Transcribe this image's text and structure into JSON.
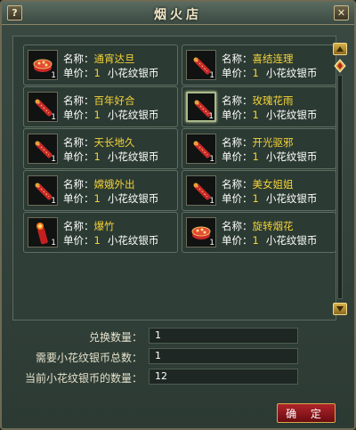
{
  "window": {
    "title": "烟火店",
    "help_label": "?",
    "close_label": "✕"
  },
  "labels": {
    "name": "名称：",
    "price": "单价："
  },
  "items": [
    {
      "name": "通宵达旦",
      "price": "1",
      "currency": "小花纹银币",
      "qty": "1",
      "icon": "firework-box-icon"
    },
    {
      "name": "喜结连理",
      "price": "1",
      "currency": "小花纹银币",
      "qty": "1",
      "icon": "firework-stick-icon"
    },
    {
      "name": "百年好合",
      "price": "1",
      "currency": "小花纹银币",
      "qty": "1",
      "icon": "firework-stick-icon"
    },
    {
      "name": "玫瑰花雨",
      "price": "1",
      "currency": "小花纹银币",
      "qty": "1",
      "icon": "firework-stick-icon"
    },
    {
      "name": "天长地久",
      "price": "1",
      "currency": "小花纹银币",
      "qty": "1",
      "icon": "firework-stick-icon"
    },
    {
      "name": "开光驱邪",
      "price": "1",
      "currency": "小花纹银币",
      "qty": "1",
      "icon": "firework-stick-icon"
    },
    {
      "name": "嫦娥外出",
      "price": "1",
      "currency": "小花纹银币",
      "qty": "1",
      "icon": "firework-stick-icon"
    },
    {
      "name": "美女姐姐",
      "price": "1",
      "currency": "小花纹银币",
      "qty": "1",
      "icon": "firework-stick-icon"
    },
    {
      "name": "爆竹",
      "price": "1",
      "currency": "小花纹银币",
      "qty": "1",
      "icon": "firecracker-icon"
    },
    {
      "name": "旋转烟花",
      "price": "1",
      "currency": "小花纹银币",
      "qty": "1",
      "icon": "firework-box-icon"
    }
  ],
  "form": {
    "exchange_qty_label": "兑换数量：",
    "exchange_qty_value": "1",
    "required_label": "需要小花纹银币总数：",
    "required_value": "1",
    "current_label": "当前小花纹银币的数量：",
    "current_value": "12"
  },
  "confirm_label": "确 定",
  "colors": {
    "value_yellow": "#f2d23a",
    "confirm_red": "#b0242a"
  }
}
